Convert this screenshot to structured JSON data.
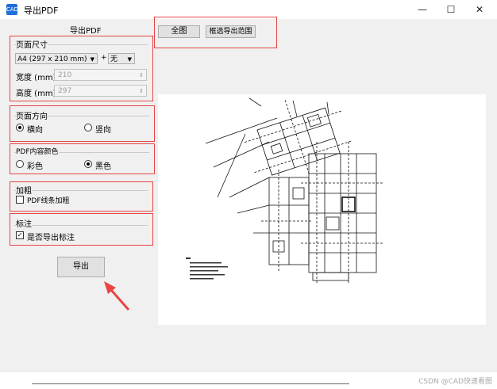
{
  "window": {
    "title": "导出PDF",
    "icon": "app-icon",
    "icon_text": "CAD",
    "controls": [
      "minimize-icon",
      "maximize-icon",
      "close-icon"
    ],
    "minimize": "—",
    "maximize": "☐",
    "close": "✕"
  },
  "panel": {
    "title": "导出PDF"
  },
  "page_size": {
    "legend": "页面尺寸",
    "paper": "A4 (297 x 210 mm)",
    "plus": "+",
    "margin": "无",
    "width_label": "宽度 (mm)",
    "width_value": "210",
    "height_label": "高度 (mm)",
    "height_value": "297"
  },
  "orientation": {
    "legend": "页面方向",
    "landscape": "横向",
    "portrait": "竖向",
    "selected": "landscape"
  },
  "color": {
    "legend": "PDF内容颜色",
    "color_label": "彩色",
    "bw_label": "黑色",
    "selected": "bw"
  },
  "bold": {
    "legend": "加粗",
    "checkbox_label": "PDF线条加粗",
    "checked": false
  },
  "annotation": {
    "legend": "标注",
    "checkbox_label": "是否导出标注",
    "checked": true,
    "check_mark": "✓"
  },
  "export_button": "导出",
  "range": {
    "full_button": "全图",
    "select_button": "框选导出范围"
  },
  "watermark": "CSDN @CAD快速看图",
  "colors": {
    "highlight": "#e64545",
    "arrow": "#e84545"
  }
}
